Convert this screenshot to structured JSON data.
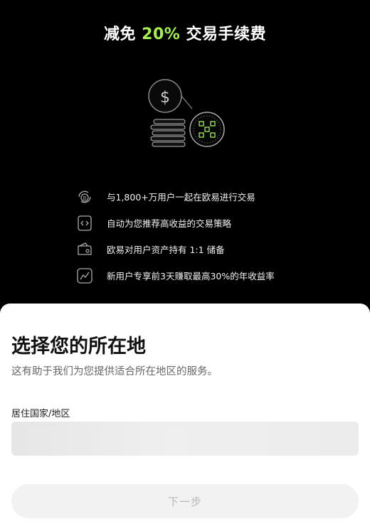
{
  "promo": {
    "title_prefix": "减免 ",
    "title_highlight": "20%",
    "title_suffix": " 交易手续费",
    "accent_color": "#a6f04a",
    "hero_icons": [
      "dollar-coin-icon",
      "coin-stack-icon",
      "okx-logo-coin-icon"
    ],
    "features": [
      {
        "icon": "bitcoin-exchange-icon",
        "text": "与1,800+万用户一起在欧易进行交易"
      },
      {
        "icon": "code-document-icon",
        "text": "自动为您推荐高收益的交易策略"
      },
      {
        "icon": "wallet-icon",
        "text": "欧易对用户资产持有 1:1 储备"
      },
      {
        "icon": "growth-chart-icon",
        "text": "新用户专享前3天赚取最高30%的年收益率"
      }
    ]
  },
  "sheet": {
    "title": "选择您的所在地",
    "subtitle": "这有助于我们为您提供适合所在地区的服务。",
    "field_label": "居住国家/地区",
    "field_value": "",
    "next_label": "下一步"
  }
}
